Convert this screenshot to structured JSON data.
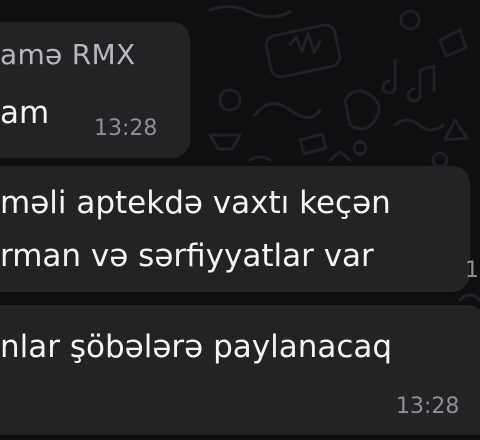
{
  "messages": [
    {
      "sender": "amə RMX",
      "lines": [
        "am"
      ],
      "time": "13:28"
    },
    {
      "lines": [
        "məli aptekdə vaxtı keçən",
        "rman və sərfiyyatlar var"
      ],
      "time": "1"
    },
    {
      "lines": [
        "nlar şöbələrə paylanacaq"
      ],
      "time": "13:28"
    }
  ],
  "colors": {
    "background": "#0e0f11",
    "bubble": "#222325",
    "text": "#f4f4f4",
    "sender": "#b8b8bc",
    "time": "#8f9094"
  }
}
